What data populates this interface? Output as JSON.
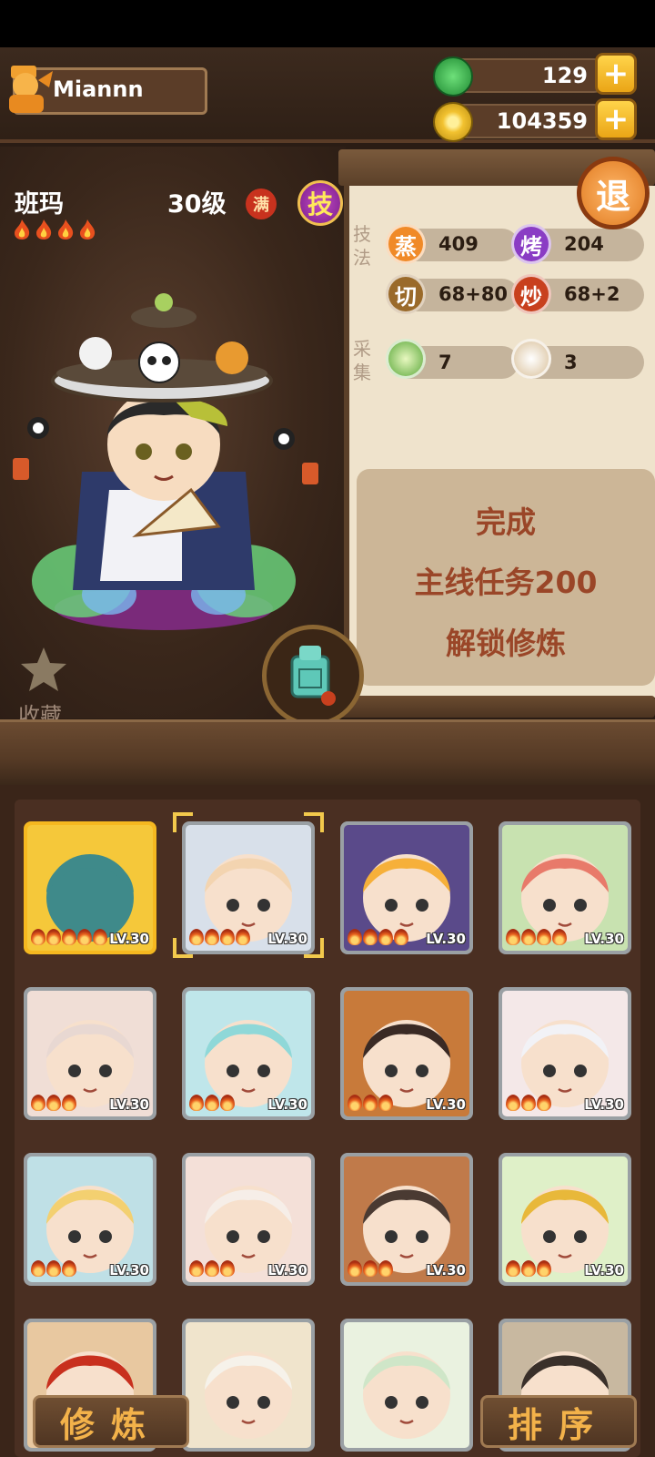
{
  "player": {
    "name": "Miannn"
  },
  "resources": {
    "jade": {
      "value": "129",
      "icon": "green-jade-icon",
      "color": "#2fb04a"
    },
    "coins": {
      "value": "104359",
      "icon": "gold-coin-icon",
      "color": "#f2c230"
    },
    "plus_label": "+"
  },
  "character": {
    "name": "班玛",
    "level": "30级",
    "max_badge": "满",
    "skill_button": "技",
    "stars": 4
  },
  "stats": {
    "skills_label": "技法",
    "gather_label": "采集",
    "steam": {
      "icon_label": "蒸",
      "value": "409",
      "color": "#f08a28"
    },
    "roast": {
      "icon_label": "烤",
      "value": "204",
      "color": "#8a3cc4"
    },
    "cut": {
      "icon_label": "切",
      "value": "68+80",
      "color": "#9a6a2a"
    },
    "fry": {
      "icon_label": "炒",
      "value": "68+2",
      "color": "#c8401e"
    },
    "veg": {
      "icon": "vegetable-icon",
      "value": "7",
      "color": "#4a9c36"
    },
    "flour": {
      "icon": "flour-icon",
      "value": "3",
      "color": "#d9c09a"
    }
  },
  "retreat_button": "退",
  "unlock": {
    "line1": "完成",
    "line2": "主线任务200",
    "line3": "解锁修炼"
  },
  "favorite_label": "收藏",
  "roster": [
    {
      "lv": "LV.30",
      "stars": 5,
      "bg": "#f5c83a",
      "skin": "#3f8a8a"
    },
    {
      "lv": "LV.30",
      "stars": 4,
      "bg": "#d8e0ea",
      "skin": "#f3d4b0",
      "selected": true
    },
    {
      "lv": "LV.30",
      "stars": 4,
      "bg": "#5a4a8a",
      "skin": "#f6b03a"
    },
    {
      "lv": "LV.30",
      "stars": 4,
      "bg": "#c8e2b0",
      "skin": "#e87a6a"
    },
    {
      "lv": "LV.30",
      "stars": 3,
      "bg": "#f0ded6",
      "skin": "#e8d8d2"
    },
    {
      "lv": "LV.30",
      "stars": 3,
      "bg": "#bfe6ea",
      "skin": "#8fd8d8"
    },
    {
      "lv": "LV.30",
      "stars": 3,
      "bg": "#c87a3a",
      "skin": "#3a2a24"
    },
    {
      "lv": "LV.30",
      "stars": 3,
      "bg": "#f4e8e8",
      "skin": "#f2f2f6"
    },
    {
      "lv": "LV.30",
      "stars": 3,
      "bg": "#bfe0e6",
      "skin": "#f3d070"
    },
    {
      "lv": "LV.30",
      "stars": 3,
      "bg": "#f4e0d8",
      "skin": "#f6eee8"
    },
    {
      "lv": "LV.30",
      "stars": 3,
      "bg": "#c07a4a",
      "skin": "#4a3a32"
    },
    {
      "lv": "LV.30",
      "stars": 3,
      "bg": "#dff0c8",
      "skin": "#e8b83a"
    },
    {
      "lv": "",
      "stars": 0,
      "bg": "#e8c8a0",
      "skin": "#c8301e"
    },
    {
      "lv": "",
      "stars": 0,
      "bg": "#f0e4cc",
      "skin": "#f6f2ea"
    },
    {
      "lv": "",
      "stars": 0,
      "bg": "#eaf2e0",
      "skin": "#cfe6c8"
    },
    {
      "lv": "",
      "stars": 0,
      "bg": "#c8b8a0",
      "skin": "#3a302a"
    }
  ],
  "buttons": {
    "cultivate": "修炼",
    "sort": "排序"
  }
}
